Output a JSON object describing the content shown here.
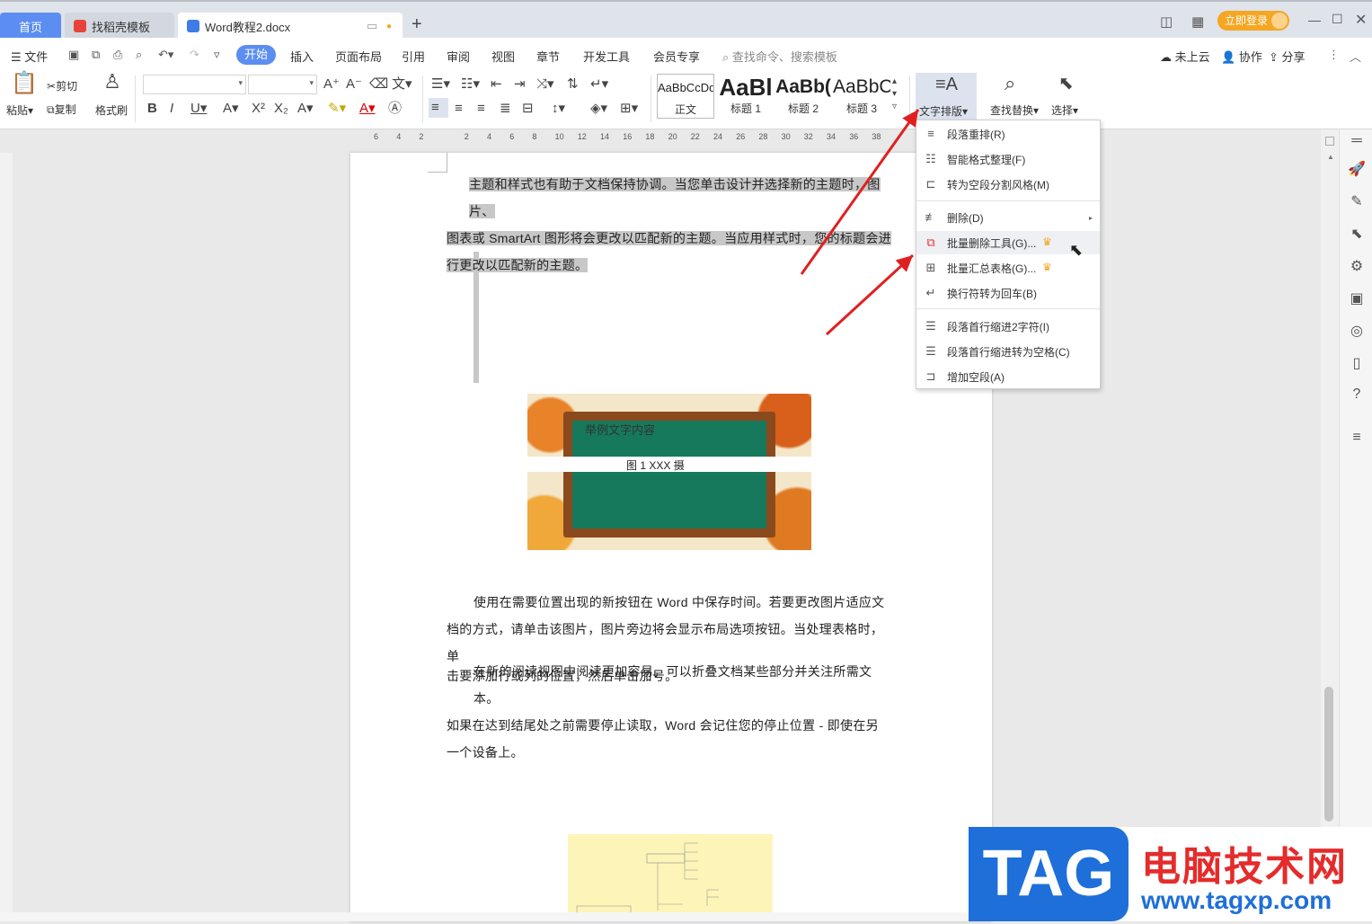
{
  "tabs": {
    "home": "首页",
    "daoke": "找稻壳模板",
    "doc": "Word教程2.docx",
    "new_tab": "+"
  },
  "titlebar": {
    "login": "立即登录"
  },
  "menubar": {
    "file": "文件",
    "items": [
      "开始",
      "插入",
      "页面布局",
      "引用",
      "审阅",
      "视图",
      "章节",
      "开发工具",
      "会员专享"
    ],
    "search": "查找命令、搜索模板",
    "cloud": "未上云",
    "collab": "协作",
    "share": "分享"
  },
  "ribbon": {
    "paste": "粘贴",
    "cut": "剪切",
    "copy": "复制",
    "format_painter": "格式刷",
    "styles": [
      {
        "sample": "AaBbCcDd",
        "label": "正文"
      },
      {
        "sample": "AaBl",
        "label": "标题 1"
      },
      {
        "sample": "AaBb(",
        "label": "标题 2"
      },
      {
        "sample": "AaBbC",
        "label": "标题 3"
      }
    ],
    "text_layout": "文字排版",
    "find_replace": "查找替换",
    "select": "选择"
  },
  "ruler": {
    "ticks": [
      "6",
      "4",
      "2",
      "",
      "2",
      "4",
      "6",
      "8",
      "10",
      "12",
      "14",
      "16",
      "18",
      "20",
      "22",
      "24",
      "26",
      "28",
      "30",
      "32",
      "34",
      "36",
      "38"
    ]
  },
  "document": {
    "para1": [
      "主题和样式也有助于文档保持协调。当您单击设计并选择新的主题时，图片、",
      "图表或 SmartArt 图形将会更改以匹配新的主题。当应用样式时，您的标题会进",
      "行更改以匹配新的主题。"
    ],
    "image_text": "举例文字内容",
    "caption": "图 1   XXX 摄",
    "para2": [
      "使用在需要位置出现的新按钮在 Word 中保存时间。若要更改图片适应文",
      "档的方式，请单击该图片，图片旁边将会显示布局选项按钮。当处理表格时，单",
      "击要添加行或列的位置，然后单击加号。"
    ],
    "para3": [
      "在新的阅读视图中阅读更加容易。可以折叠文档某些部分并关注所需文本。",
      "如果在达到结尾处之前需要停止读取，Word 会记住您的停止位置 - 即使在另",
      "一个设备上。"
    ]
  },
  "dropdown": {
    "items": [
      "段落重排(R)",
      "智能格式整理(F)",
      "转为空段分割风格(M)",
      "删除(D)",
      "批量删除工具(G)...",
      "批量汇总表格(G)...",
      "换行符转为回车(B)",
      "段落首行缩进2字符(I)",
      "段落首行缩进转为空格(C)",
      "增加空段(A)"
    ]
  },
  "watermark": {
    "tag": "TAG",
    "site_name": "电脑技术网",
    "url": "www.tagxp.com"
  },
  "colors": {
    "accent": "#5b8ef0",
    "arrow": "#e02020",
    "selection": "#c8c8c8",
    "login": "#f5a623"
  }
}
